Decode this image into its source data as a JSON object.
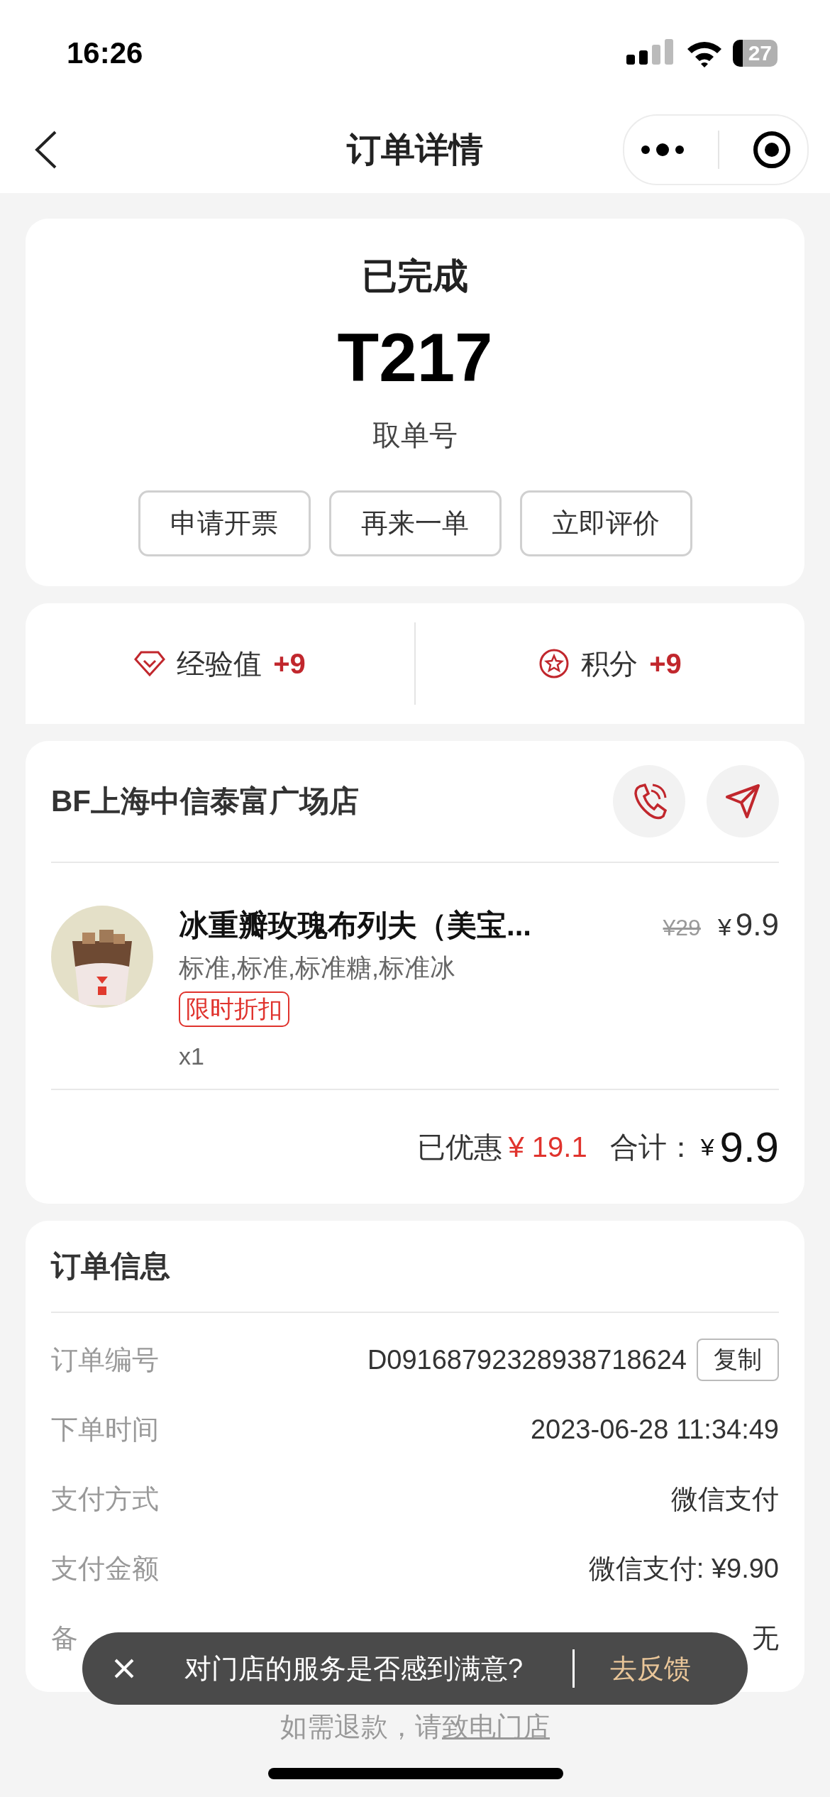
{
  "status_bar": {
    "time": "16:26",
    "battery": "27"
  },
  "nav": {
    "title": "订单详情"
  },
  "order": {
    "status": "已完成",
    "pickup_number": "T217",
    "pickup_label": "取单号",
    "actions": [
      "申请开票",
      "再来一单",
      "立即评价"
    ]
  },
  "rewards": [
    {
      "kind": "experience",
      "label": "经验值",
      "value": "+9"
    },
    {
      "kind": "points",
      "label": "积分",
      "value": "+9"
    }
  ],
  "store": {
    "name": "BF上海中信泰富广场店"
  },
  "items": [
    {
      "name": "冰重瓣玫瑰布列夫（美宝...",
      "options": "标准,标准,标准糖,标准冰",
      "tag": "限时折扣",
      "quantity": "x1",
      "original_price": "¥29",
      "currency": "¥",
      "price": "9.9"
    }
  ],
  "summary": {
    "discount_label": "已优惠",
    "discount": "¥ 19.1",
    "total_label": "合计：",
    "total_currency": "¥",
    "total": "9.9"
  },
  "order_info": {
    "title": "订单信息",
    "rows": [
      {
        "label": "订单编号",
        "value": "D09168792328938718624",
        "action": "复制"
      },
      {
        "label": "下单时间",
        "value": "2023-06-28 11:34:49"
      },
      {
        "label": "支付方式",
        "value": "微信支付"
      },
      {
        "label": "支付金额",
        "value": "微信支付: ¥9.90"
      },
      {
        "label": "备",
        "value": "无"
      }
    ]
  },
  "toast": {
    "message": "对门店的服务是否感到满意?",
    "action": "去反馈"
  },
  "footer": {
    "text": "如需退款，请",
    "link": "致电门店"
  }
}
